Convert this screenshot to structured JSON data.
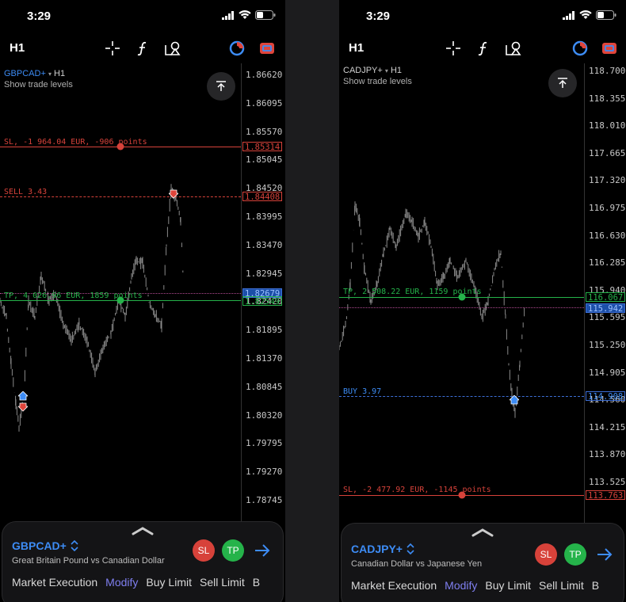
{
  "left": {
    "time": "3:29",
    "timeframe": "H1",
    "symbol": "GBPCAD+",
    "period": "H1",
    "show_trade_levels": "Show trade levels",
    "axis_ticks": [
      "1.86620",
      "1.86095",
      "1.85570",
      "1.85045",
      "1.84520",
      "1.83995",
      "1.83470",
      "1.82945",
      "1.82420",
      "1.81895",
      "1.81370",
      "1.80845",
      "1.80320",
      "1.79795",
      "1.79270",
      "1.78745"
    ],
    "levels": {
      "sl": {
        "text": "SL, -1 964.04 EUR, -906 points",
        "price": "1.85314",
        "color": "#d7423a"
      },
      "sell": {
        "text": "SELL 3.43",
        "price": "1.84408",
        "color": "#d7423a"
      },
      "tp": {
        "text": "TP, 4 026.96 EUR, 1859 points",
        "price": "1.82549",
        "color": "#25b34a"
      },
      "bid": {
        "price": "1.82679",
        "color": "#3d6fd8"
      }
    },
    "panel": {
      "symbol": "GBPCAD+",
      "description": "Great Britain Pound vs Canadian Dollar",
      "sl_label": "SL",
      "tp_label": "TP",
      "tabs": [
        "Market Execution",
        "Modify",
        "Buy Limit",
        "Sell Limit",
        "B"
      ]
    }
  },
  "right": {
    "time": "3:29",
    "timeframe": "H1",
    "symbol": "CADJPY+",
    "period": "H1",
    "show_trade_levels": "Show trade levels",
    "axis_ticks": [
      "118.700",
      "118.355",
      "118.010",
      "117.665",
      "117.320",
      "116.975",
      "116.630",
      "116.285",
      "115.940",
      "115.595",
      "115.250",
      "114.905",
      "114.560",
      "114.215",
      "113.870",
      "113.525"
    ],
    "levels": {
      "tp": {
        "text": "TP, 2 508.22 EUR, 1159 points",
        "price": "116.067",
        "color": "#25b34a"
      },
      "bid": {
        "price": "115.942",
        "color": "#3d6fd8"
      },
      "buy": {
        "text": "BUY 3.97",
        "price": "114.908",
        "color": "#3d6fd8"
      },
      "sl": {
        "text": "SL, -2 477.92 EUR, -1145 points",
        "price": "113.763",
        "color": "#d7423a"
      }
    },
    "panel": {
      "symbol": "CADJPY+",
      "description": "Canadian Dollar vs Japanese Yen",
      "sl_label": "SL",
      "tp_label": "TP",
      "tabs": [
        "Market Execution",
        "Modify",
        "Buy Limit",
        "Sell Limit",
        "B"
      ]
    }
  }
}
